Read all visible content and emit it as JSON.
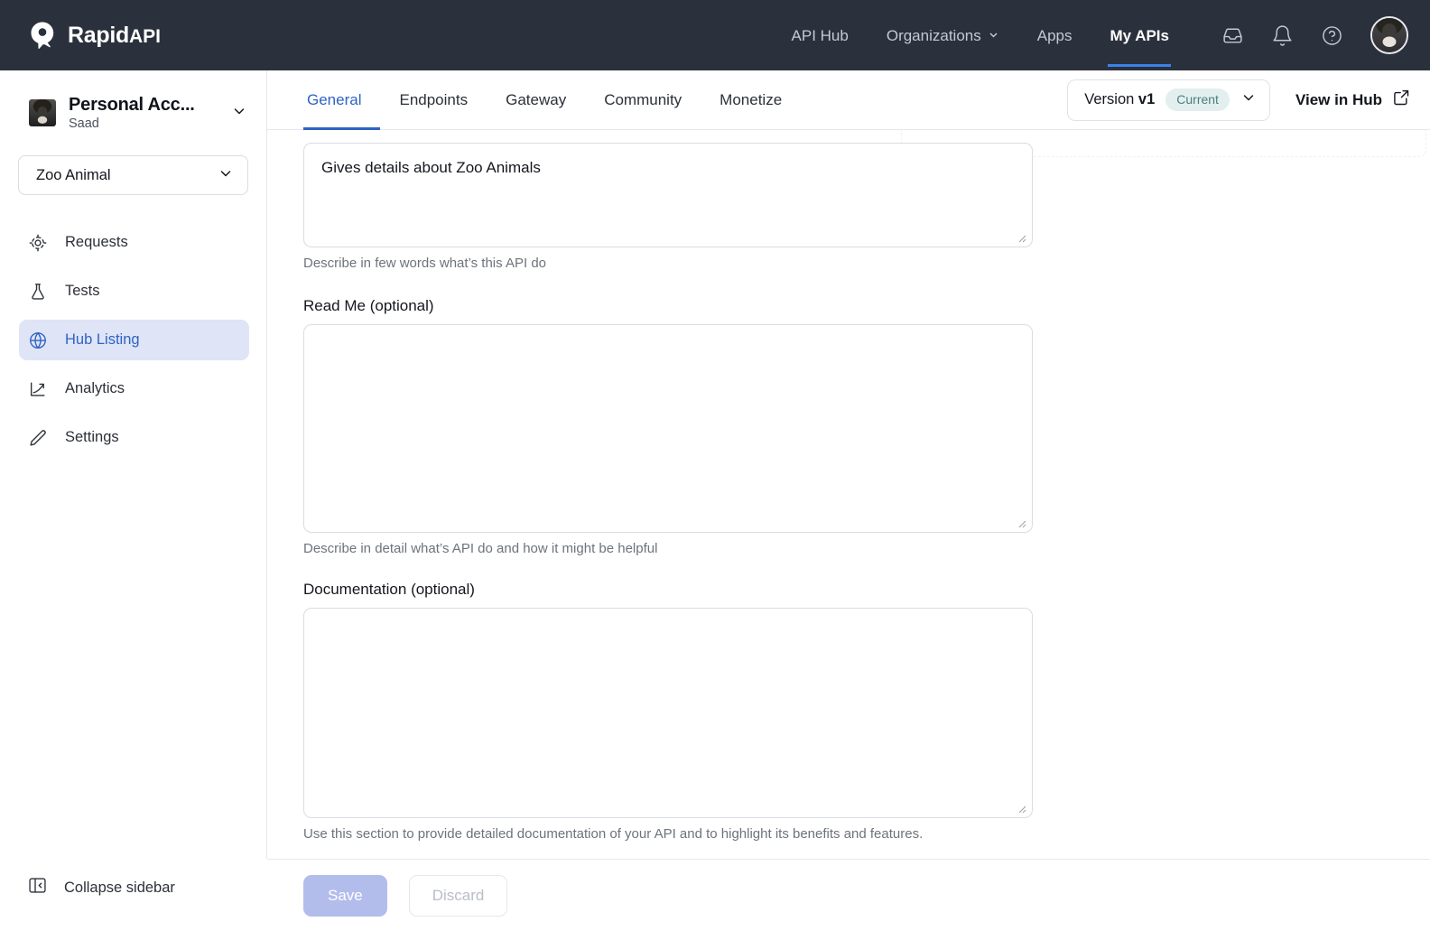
{
  "header": {
    "brand_name": "Rapid",
    "brand_suffix": "API",
    "nav": [
      {
        "label": "API Hub",
        "icon": "",
        "active": false
      },
      {
        "label": "Organizations",
        "icon": "chevron-down-icon",
        "active": false
      },
      {
        "label": "Apps",
        "icon": "",
        "active": false
      },
      {
        "label": "My APIs",
        "icon": "",
        "active": true
      }
    ],
    "icons": [
      "inbox-icon",
      "bell-icon",
      "help-circle-icon",
      "avatar"
    ]
  },
  "sidebar": {
    "account_name": "Personal Acc...",
    "account_user": "Saad",
    "api_select_value": "Zoo Animal",
    "items": [
      {
        "label": "Requests",
        "icon": "target-icon",
        "active": false
      },
      {
        "label": "Tests",
        "icon": "flask-icon",
        "active": false
      },
      {
        "label": "Hub Listing",
        "icon": "globe-icon",
        "active": true
      },
      {
        "label": "Analytics",
        "icon": "trending-up-icon",
        "active": false
      },
      {
        "label": "Settings",
        "icon": "pencil-icon",
        "active": false
      }
    ],
    "collapse_label": "Collapse sidebar",
    "collapse_icon": "panel-collapse-icon"
  },
  "tabs": [
    {
      "label": "General",
      "active": true
    },
    {
      "label": "Endpoints",
      "active": false
    },
    {
      "label": "Gateway",
      "active": false
    },
    {
      "label": "Community",
      "active": false
    },
    {
      "label": "Monetize",
      "active": false
    }
  ],
  "version": {
    "prefix": "Version",
    "value": "v1",
    "badge": "Current",
    "chevron_icon": "chevron-down-icon"
  },
  "view_in_hub": {
    "label": "View in Hub",
    "icon": "external-link-icon"
  },
  "form": {
    "description": {
      "value": "Gives details about Zoo Animals",
      "placeholder": "",
      "hint": "Describe in few words what’s this API do"
    },
    "readme": {
      "label": "Read Me (optional)",
      "value": "",
      "placeholder": "",
      "hint": "Describe in detail what’s API do and how it might be helpful"
    },
    "documentation": {
      "label": "Documentation (optional)",
      "value": "",
      "placeholder": "",
      "hint": "Use this section to provide detailed documentation of your API and to highlight its benefits and features."
    }
  },
  "footer": {
    "save_label": "Save",
    "discard_label": "Discard"
  },
  "colors": {
    "header_bg": "#2b313c",
    "accent_blue": "#2f63c4",
    "nav_active_underline": "#3b82e8",
    "sidebar_active_bg": "#dfe4f7",
    "badge_bg": "#e3efef",
    "badge_text": "#4a7f82",
    "save_bg": "#b3bdec"
  }
}
